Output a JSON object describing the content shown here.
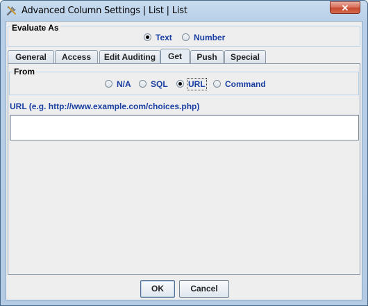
{
  "window": {
    "title": "Advanced Column Settings | List | List",
    "close_glyph": "✕",
    "app_icon": "tools-icon"
  },
  "evaluate_as": {
    "legend": "Evaluate As",
    "options": [
      {
        "label": "Text",
        "selected": true
      },
      {
        "label": "Number",
        "selected": false
      }
    ]
  },
  "tabs": [
    {
      "label": "General",
      "selected": false
    },
    {
      "label": "Access",
      "selected": false
    },
    {
      "label": "Edit Auditing",
      "selected": false
    },
    {
      "label": "Get",
      "selected": true
    },
    {
      "label": "Push",
      "selected": false
    },
    {
      "label": "Special",
      "selected": false
    }
  ],
  "get_tab": {
    "from": {
      "legend": "From",
      "options": [
        {
          "label": "N/A",
          "selected": false
        },
        {
          "label": "SQL",
          "selected": false
        },
        {
          "label": "URL",
          "selected": true
        },
        {
          "label": "Command",
          "selected": false
        }
      ]
    },
    "url_field": {
      "label": "URL (e.g. http://www.example.com/choices.php)",
      "value": "",
      "placeholder": ""
    }
  },
  "buttons": {
    "ok_label": "OK",
    "cancel_label": "Cancel"
  },
  "colors": {
    "accent_label": "#1a3fa3",
    "title_gradient": "#b7cfe8",
    "close_button": "#c54a32"
  }
}
